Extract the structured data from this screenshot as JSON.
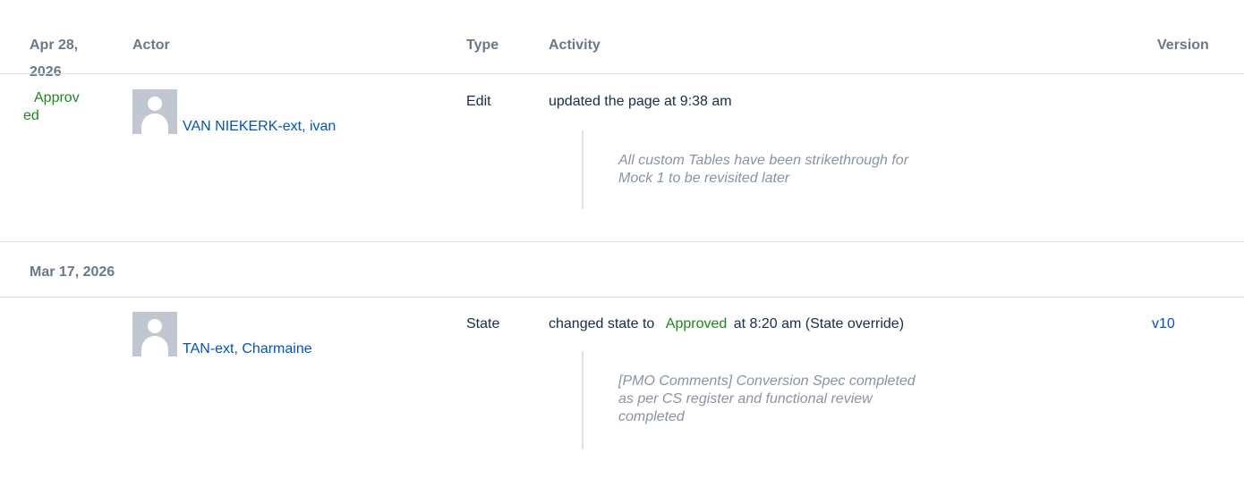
{
  "header": {
    "date": "Apr 28,\n2026",
    "actor": "Actor",
    "type": "Type",
    "activity": "Activity",
    "version": "Version"
  },
  "entries": [
    {
      "state_badge": "Approv\ned",
      "actor": "VAN NIEKERK-ext, ivan",
      "type": "Edit",
      "activity": "updated the page at 9:38 am",
      "comment": "All custom Tables have been strikethrough for\nMock 1 to be revisited later",
      "version": ""
    },
    {
      "date_group": "Mar 17, 2026",
      "actor": "TAN-ext, Charmaine",
      "type": "State",
      "activity_prefix": "changed state to",
      "activity_state": "Approved",
      "activity_suffix": "at 8:20 am (State override)",
      "comment": "[PMO Comments] Conversion Spec completed\nas per CS register and functional review\ncompleted",
      "version": "v10"
    }
  ],
  "icons": {
    "avatar": "default-user-avatar-icon"
  },
  "colors": {
    "link": "#0052cc",
    "approved": "#1a8a1a",
    "header_text": "#6b778c",
    "comment_text": "#8993a4",
    "divider": "#dfe1e6"
  }
}
